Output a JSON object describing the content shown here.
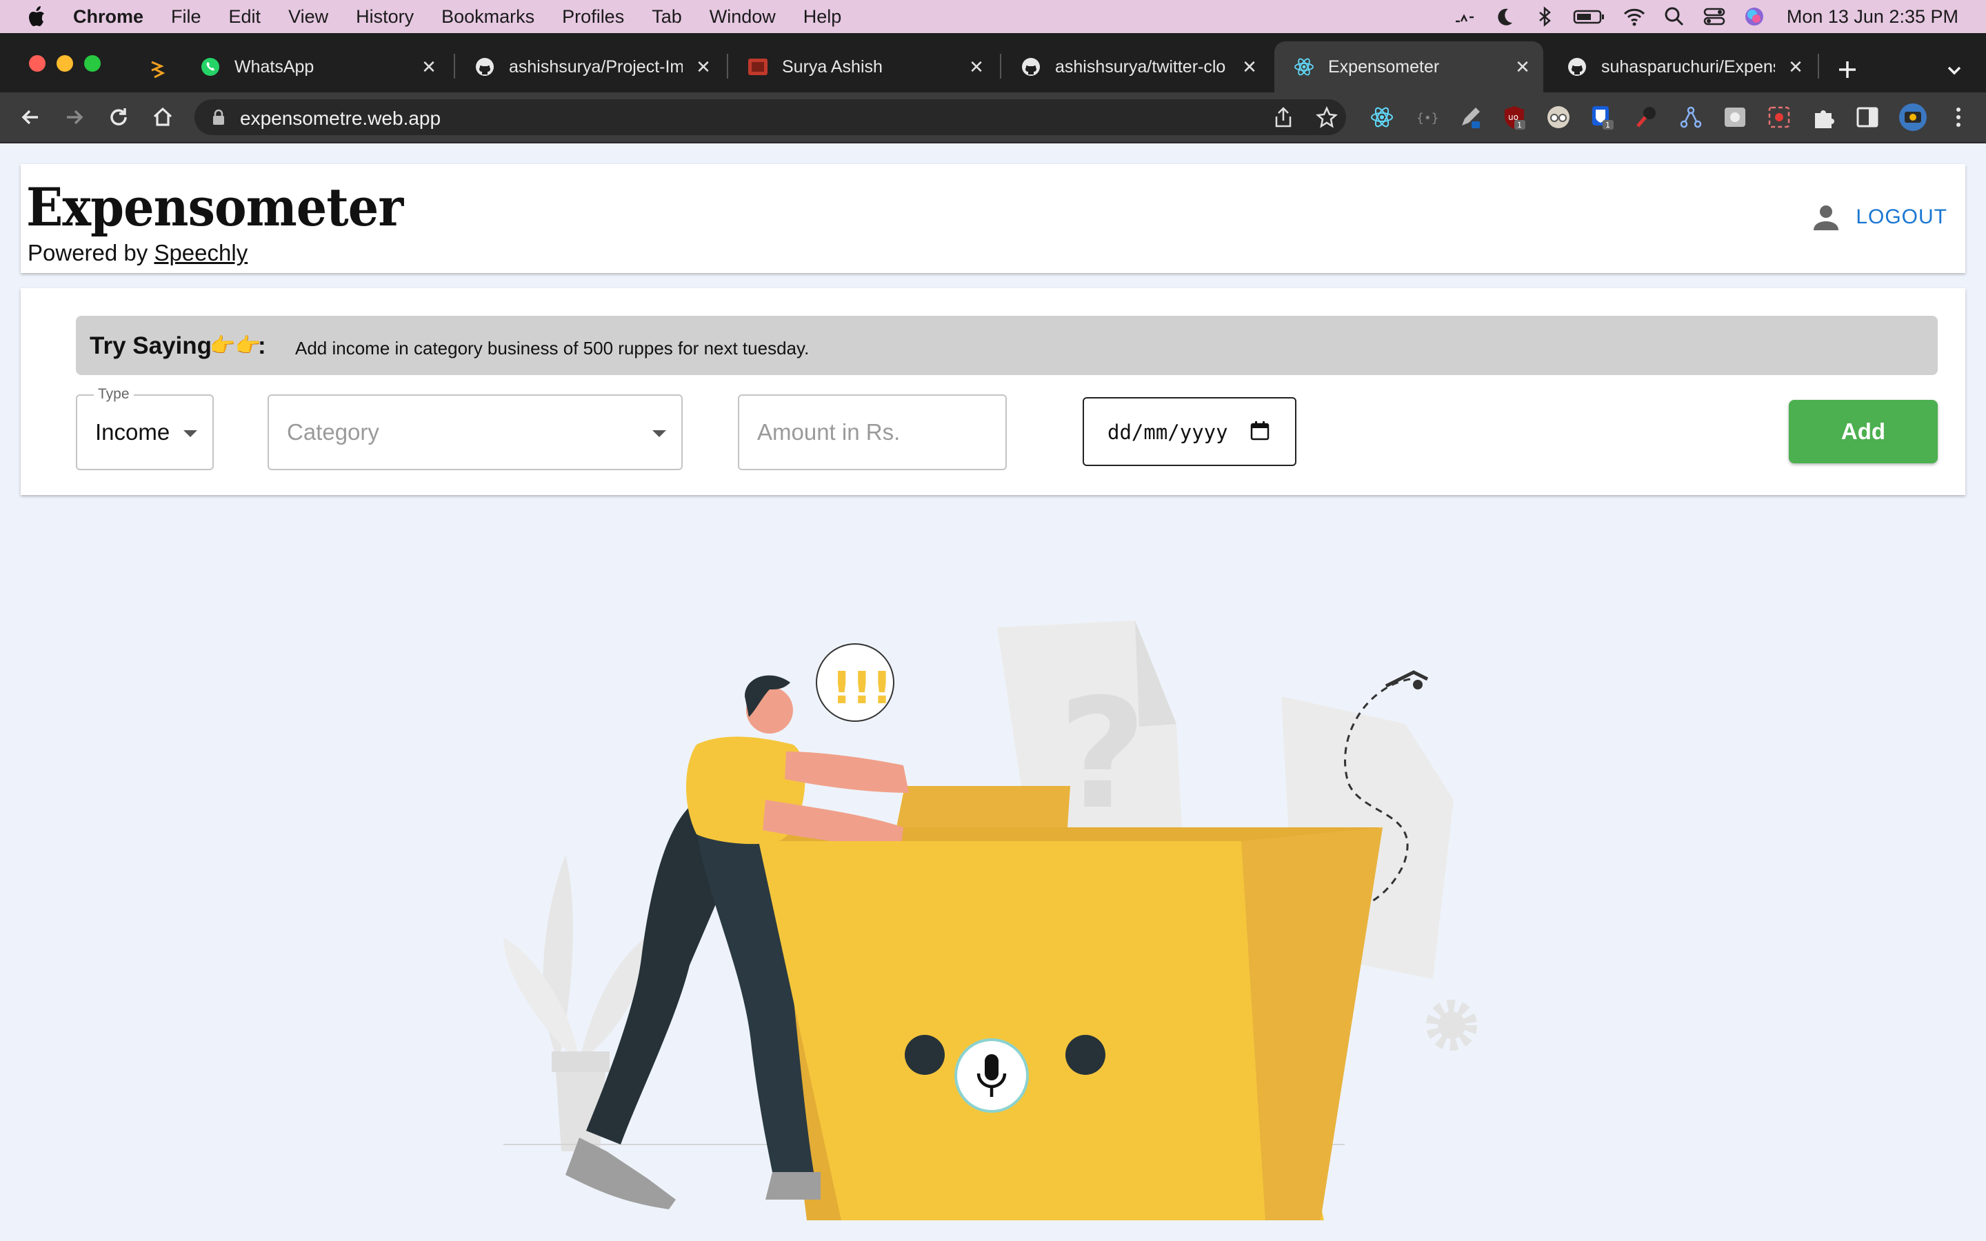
{
  "menubar": {
    "app": "Chrome",
    "items": [
      "File",
      "Edit",
      "View",
      "History",
      "Bookmarks",
      "Profiles",
      "Tab",
      "Window",
      "Help"
    ],
    "clock": "Mon 13 Jun  2:35 PM"
  },
  "tabs": [
    {
      "title": "WhatsApp",
      "icon": "whatsapp-icon"
    },
    {
      "title": "ashishsurya/Project-Im",
      "icon": "github-icon"
    },
    {
      "title": "Surya Ashish",
      "icon": "site-favicon"
    },
    {
      "title": "ashishsurya/twitter-clo",
      "icon": "github-icon"
    },
    {
      "title": "Expensometer",
      "icon": "react-icon"
    },
    {
      "title": "suhasparuchuri/Expens",
      "icon": "github-icon"
    }
  ],
  "toolbar": {
    "url": "expensometre.web.app"
  },
  "header": {
    "logo": "Expensometer",
    "powered_prefix": "Powered by ",
    "powered_link": "Speechly",
    "logout": "LOGOUT"
  },
  "hint": {
    "title": "Try Saying",
    "emoji": "👉👉",
    "colon": ":",
    "text": "Add income in category business of 500 ruppes for next tuesday."
  },
  "form": {
    "type_label": "Type",
    "type_value": "Income",
    "category_placeholder": "Category",
    "amount_placeholder": "Amount in Rs.",
    "date_placeholder": "dd/mm/yyyy",
    "add_label": "Add"
  },
  "illustration": {
    "exclaim": "!!!",
    "question": "?"
  }
}
